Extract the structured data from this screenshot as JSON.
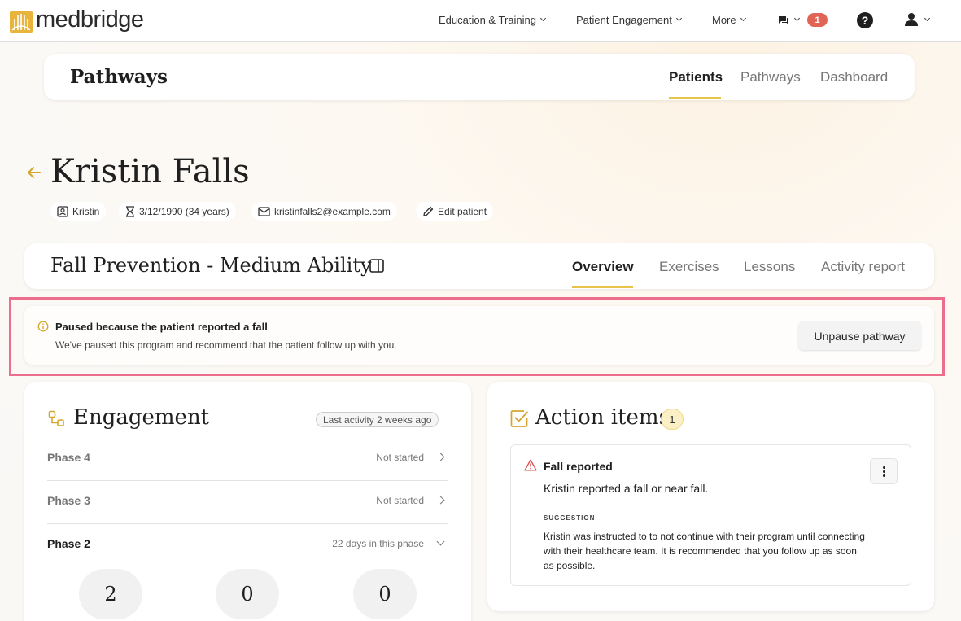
{
  "topnav": {
    "brand": "medbridge",
    "education": "Education & Training",
    "engagement": "Patient Engagement",
    "more": "More",
    "notification_count": "1",
    "help": "?"
  },
  "pathways_header": {
    "title": "Pathways",
    "tabs": [
      "Patients",
      "Pathways",
      "Dashboard"
    ],
    "active_tab": "Patients"
  },
  "patient": {
    "name": "Kristin Falls",
    "first_name": "Kristin",
    "dob": "3/12/1990 (34 years)",
    "email": "kristinfalls2@example.com",
    "edit_label": "Edit patient"
  },
  "program": {
    "title": "Fall Prevention - Medium Ability",
    "tabs": [
      "Overview",
      "Exercises",
      "Lessons",
      "Activity report"
    ],
    "active_tab": "Overview"
  },
  "alert": {
    "title": "Paused because the patient reported a fall",
    "text": "We've paused this program and recommend that the patient follow up with you.",
    "button": "Unpause pathway"
  },
  "engagement": {
    "title": "Engagement",
    "last_activity": "Last activity 2 weeks ago",
    "phases": [
      {
        "name": "Phase 4",
        "status": "Not started"
      },
      {
        "name": "Phase 3",
        "status": "Not started"
      },
      {
        "name": "Phase 2",
        "status": "22 days in this phase"
      }
    ],
    "stats": [
      "2",
      "0",
      "0"
    ]
  },
  "action_items": {
    "title": "Action items",
    "count": "1",
    "item": {
      "title": "Fall reported",
      "description": "Kristin reported a fall or near fall.",
      "suggestion_label": "SUGGESTION",
      "suggestion": "Kristin was instructed to to not continue with their program until connecting with their healthcare team. It is recommended that you follow up as soon as possible."
    }
  },
  "colors": {
    "accent": "#e8c34a",
    "highlight": "#ec6d8c",
    "notification": "#e06557",
    "warning": "#d9534f"
  }
}
